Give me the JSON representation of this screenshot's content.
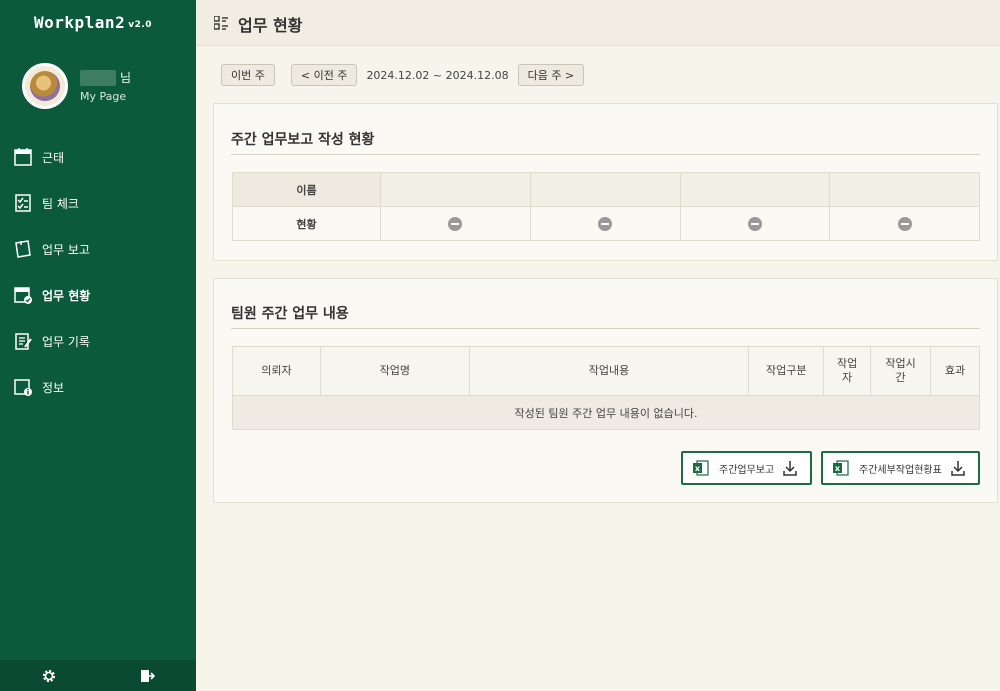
{
  "brand": {
    "name": "Workplan2",
    "version": "v2.0"
  },
  "profile": {
    "name_suffix": "님",
    "mypage_label": "My Page"
  },
  "nav": [
    {
      "label": "근태",
      "icon": "calendar-icon"
    },
    {
      "label": "팀 체크",
      "icon": "checklist-icon"
    },
    {
      "label": "업무 보고",
      "icon": "report-icon"
    },
    {
      "label": "업무 현황",
      "icon": "calendar-check-icon",
      "active": true
    },
    {
      "label": "업무 기록",
      "icon": "notes-icon"
    },
    {
      "label": "정보",
      "icon": "info-icon"
    }
  ],
  "footer": {
    "settings_icon": "gear-icon",
    "logout_icon": "logout-icon"
  },
  "header": {
    "title": "업무 현황",
    "icon": "list-icon"
  },
  "week_nav": {
    "this_week": "이번 주",
    "prev_week": "< 이전 주",
    "date_range": "2024.12.02 ~ 2024.12.08",
    "next_week": "다음 주 >"
  },
  "weekly_status": {
    "title": "주간 업무보고 작성 현황",
    "row_labels": {
      "name": "이름",
      "status": "현황"
    }
  },
  "team_tasks": {
    "title": "팀원 주간 업무 내용",
    "columns": [
      "의뢰자",
      "작업명",
      "작업내용",
      "작업구분",
      "작업자",
      "작업시간",
      "효과"
    ],
    "column_display": [
      "의뢰자",
      "작업명",
      "작업내용",
      "작업구분",
      "작업\n자",
      "작업시\n간",
      "효과"
    ],
    "empty_message": "작성된 팀원 주간 업무 내용이 없습니다."
  },
  "buttons": {
    "weekly_report": "주간업무보고",
    "weekly_detail": "주간세부작업현황표"
  },
  "colors": {
    "sidebar": "#0c5a3c",
    "accent": "#1d6b43",
    "background": "#f7f4ec"
  }
}
